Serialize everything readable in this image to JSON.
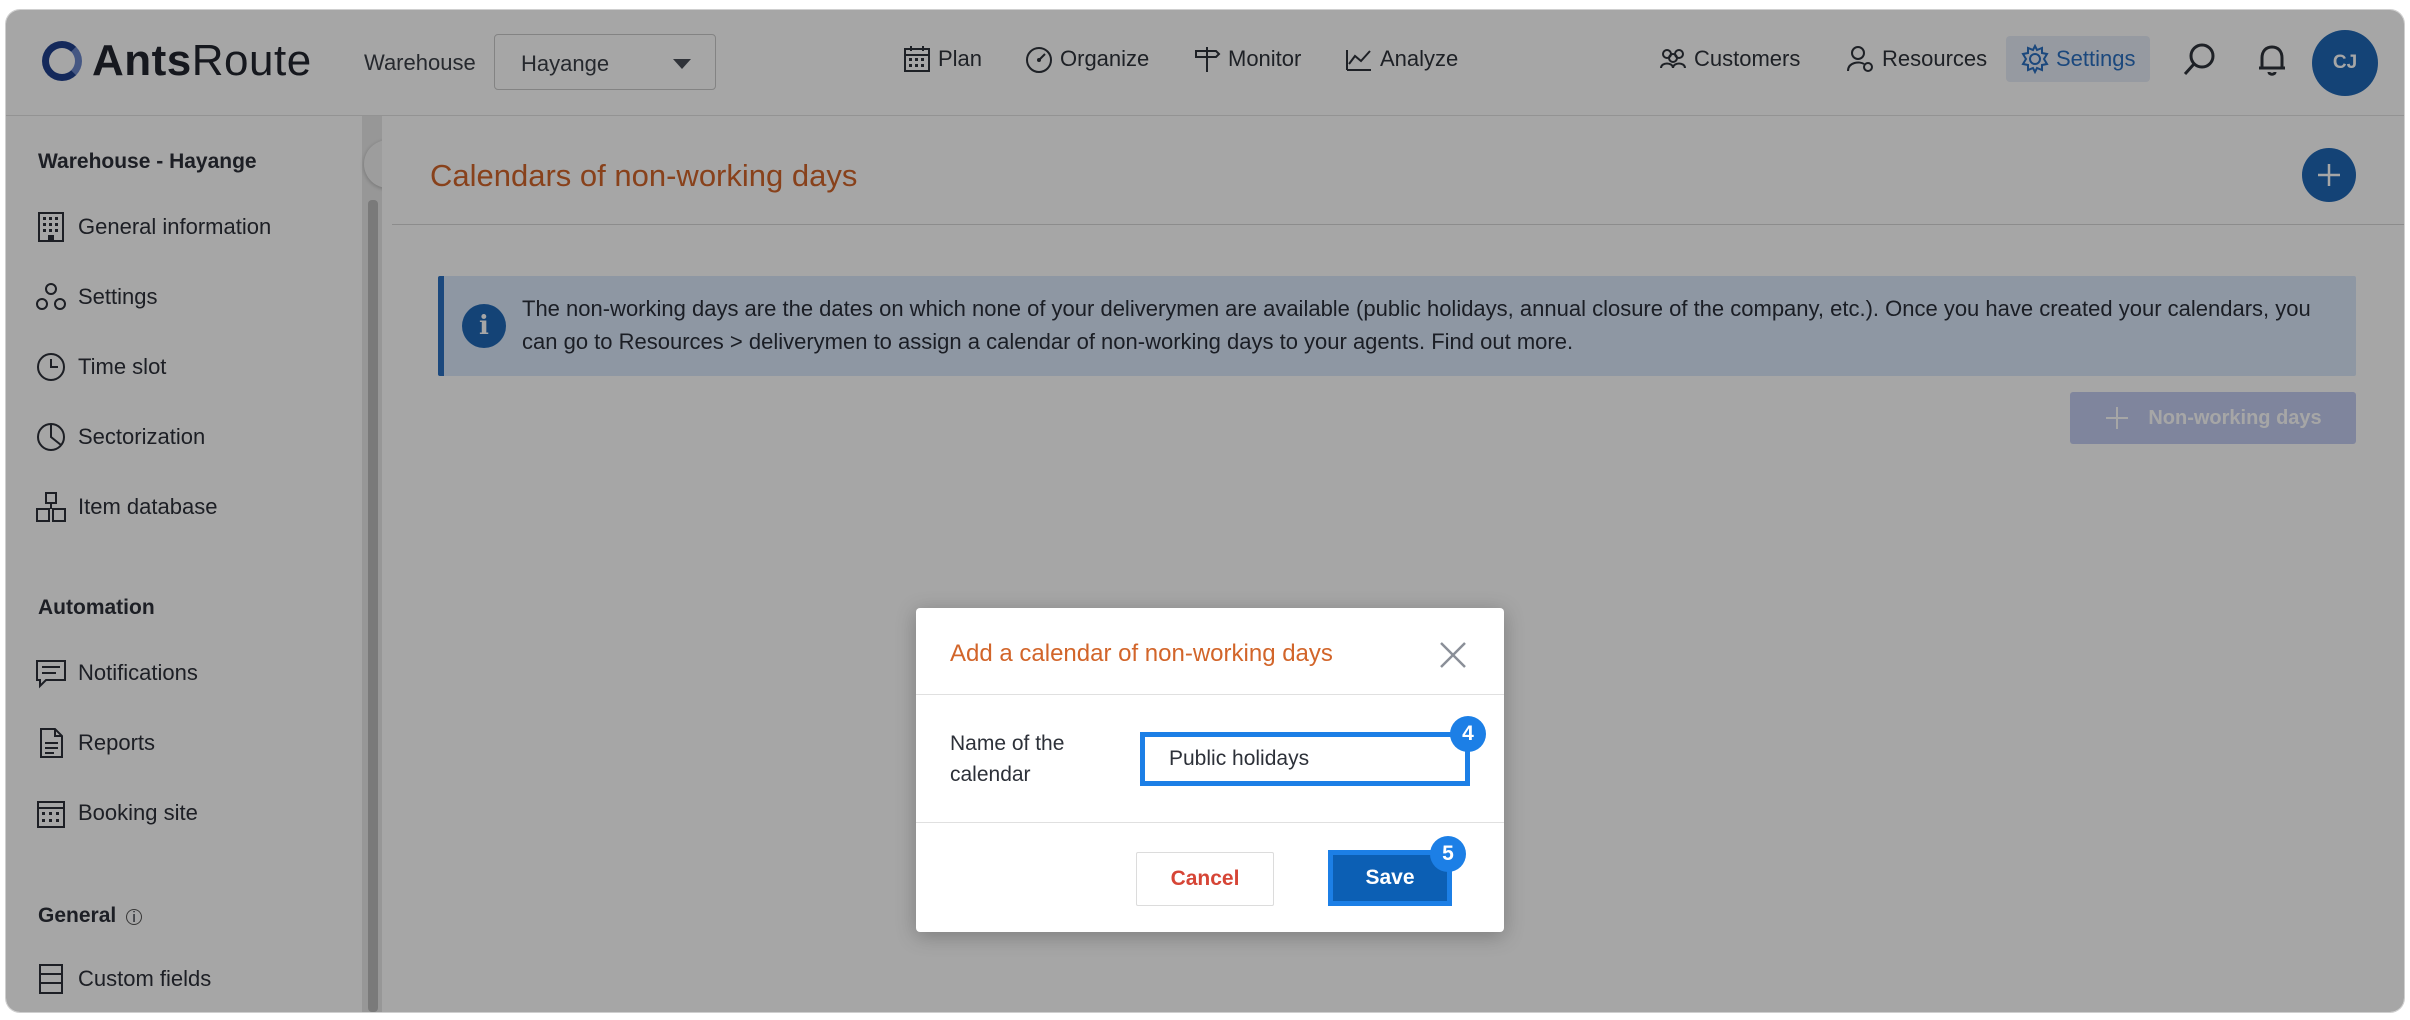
{
  "app": {
    "logo_bold": "Ants",
    "logo_light": "Route"
  },
  "header": {
    "warehouse_label": "Warehouse",
    "warehouse_value": "Hayange",
    "nav": {
      "plan": "Plan",
      "organize": "Organize",
      "monitor": "Monitor",
      "analyze": "Analyze",
      "customers": "Customers",
      "resources": "Resources",
      "settings": "Settings"
    },
    "avatar_initials": "CJ"
  },
  "sidebar": {
    "warehouse_heading": "Warehouse - Hayange",
    "items_warehouse": [
      {
        "label": "General information",
        "icon": "building-icon"
      },
      {
        "label": "Settings",
        "icon": "cogs-icon"
      },
      {
        "label": "Time slot",
        "icon": "clock-icon"
      },
      {
        "label": "Sectorization",
        "icon": "pie-chart-icon"
      },
      {
        "label": "Item database",
        "icon": "boxes-icon"
      }
    ],
    "automation_heading": "Automation",
    "items_automation": [
      {
        "label": "Notifications",
        "icon": "message-icon"
      },
      {
        "label": "Reports",
        "icon": "document-icon"
      },
      {
        "label": "Booking site",
        "icon": "calendar-icon"
      }
    ],
    "general_heading": "General",
    "items_general": [
      {
        "label": "Custom fields",
        "icon": "list-icon"
      }
    ]
  },
  "main": {
    "page_title": "Calendars of non-working days",
    "info_text": "The non-working days are the dates on which none of your deliverymen are available (public holidays, annual closure of the company, etc.). Once you have created your calendars, you can go to Resources > deliverymen to assign a calendar of non-working days to your agents. Find out more.",
    "non_working_button": "Non-working days"
  },
  "modal": {
    "title": "Add a calendar of non-working days",
    "field_label": "Name of the calendar",
    "field_value": "Public holidays",
    "cancel_label": "Cancel",
    "save_label": "Save",
    "step_badge_input": "4",
    "step_badge_save": "5"
  },
  "colors": {
    "accent_blue": "#1f67b5",
    "title_orange": "#d2652a",
    "highlight_blue": "#1c7fe6",
    "cancel_red": "#d64536"
  }
}
